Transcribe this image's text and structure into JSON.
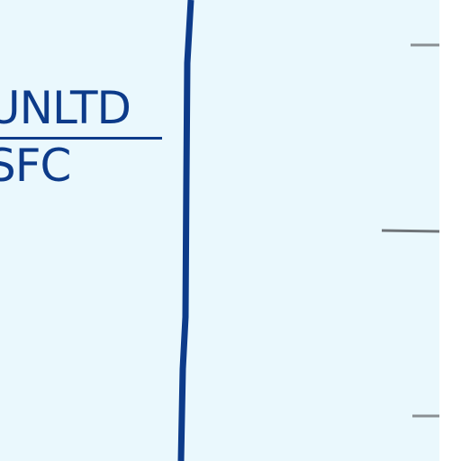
{
  "limit_block": {
    "upper": "UNLTD",
    "lower": "SFC"
  },
  "colors": {
    "background": "#eaf8fd",
    "line": "#0d3b8a",
    "tick": "#8a8f93"
  }
}
